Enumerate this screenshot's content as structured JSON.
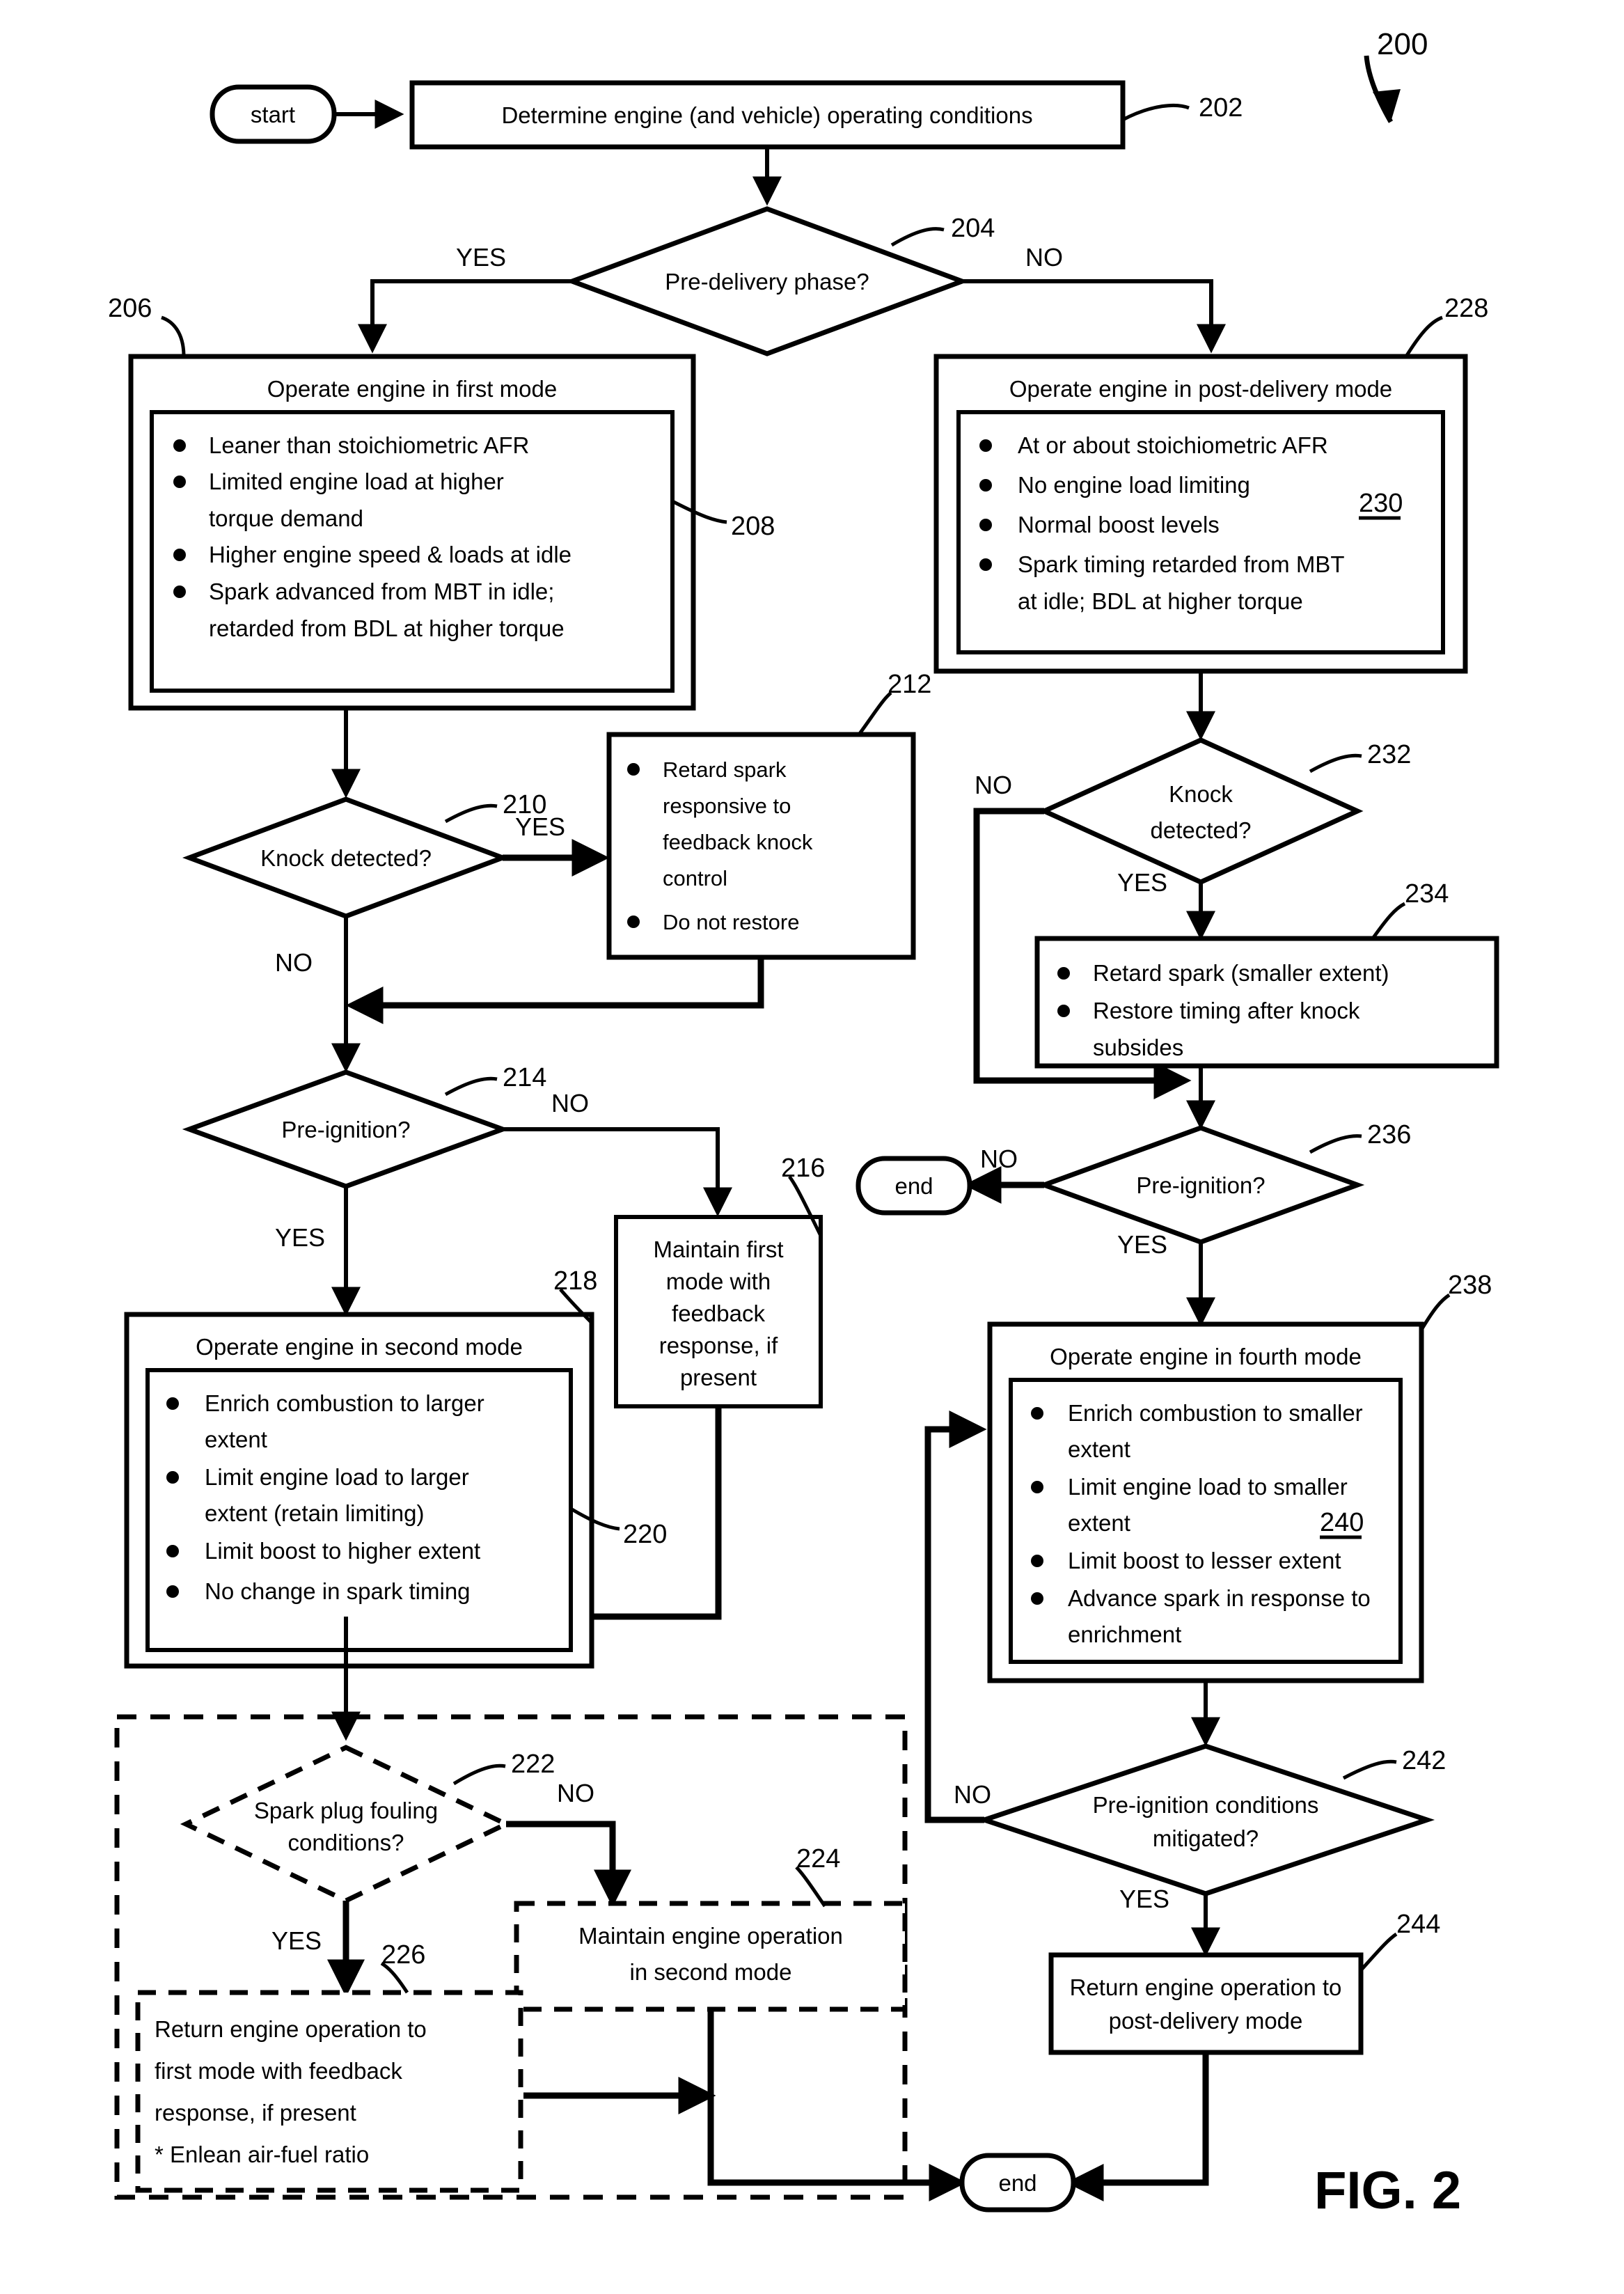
{
  "figure": {
    "label": "FIG. 2",
    "method_ref": "200"
  },
  "terminators": {
    "start": "start",
    "end_mid": "end",
    "end_bottom": "end"
  },
  "edge_labels": {
    "yes": "YES",
    "no": "NO"
  },
  "nodes": {
    "n202": {
      "ref": "202",
      "text": "Determine engine (and vehicle) operating conditions"
    },
    "n204": {
      "ref": "204",
      "text": "Pre-delivery phase?",
      "yes": "YES",
      "no": "NO"
    },
    "n206": {
      "ref": "206",
      "title": "Operate engine in first mode",
      "inner_ref": "208",
      "bullets": [
        "Leaner than stoichiometric AFR",
        "Limited engine load at higher torque demand",
        "Higher engine speed & loads at idle",
        "Spark advanced from MBT in idle; retarded from BDL at higher torque"
      ]
    },
    "n210": {
      "ref": "210",
      "text": "Knock detected?",
      "yes": "YES",
      "no": "NO"
    },
    "n212": {
      "ref": "212",
      "bullets": [
        "Retard spark responsive to feedback knock control",
        "Do not restore"
      ]
    },
    "n214": {
      "ref": "214",
      "text": "Pre-ignition?",
      "yes": "YES",
      "no": "NO"
    },
    "n216": {
      "ref": "216",
      "text": "Maintain first mode with feedback response, if present"
    },
    "n218": {
      "ref": "218",
      "title": "Operate engine in second mode",
      "inner_ref": "220",
      "bullets": [
        "Enrich combustion to larger extent",
        "Limit engine load to larger extent (retain limiting)",
        "Limit boost to higher extent",
        "No change in spark timing"
      ]
    },
    "n222": {
      "ref": "222",
      "text": "Spark plug fouling conditions?",
      "yes": "YES",
      "no": "NO"
    },
    "n224": {
      "ref": "224",
      "text": "Maintain engine operation in second mode"
    },
    "n226": {
      "ref": "226",
      "lines": [
        "Return engine operation to",
        "first mode with feedback",
        "response, if present",
        "* Enlean air-fuel ratio"
      ]
    },
    "n228": {
      "ref": "228",
      "title": "Operate engine in post-delivery mode",
      "inner_ref": "230",
      "bullets": [
        "At or about stoichiometric AFR",
        "No engine load limiting",
        "Normal boost levels",
        "Spark timing retarded from MBT at idle; BDL at higher torque"
      ]
    },
    "n232": {
      "ref": "232",
      "text_line1": "Knock",
      "text_line2": "detected?",
      "yes": "YES",
      "no": "NO"
    },
    "n234": {
      "ref": "234",
      "bullets": [
        "Retard spark (smaller extent)",
        "Restore timing after knock subsides"
      ]
    },
    "n236": {
      "ref": "236",
      "text": "Pre-ignition?",
      "yes": "YES",
      "no": "NO"
    },
    "n238": {
      "ref": "238",
      "title": "Operate engine in fourth mode",
      "inner_ref": "240",
      "bullets": [
        "Enrich combustion to smaller extent",
        "Limit engine load to smaller extent",
        "Limit boost to lesser extent",
        "Advance spark in response to enrichment"
      ]
    },
    "n242": {
      "ref": "242",
      "text_line1": "Pre-ignition conditions",
      "text_line2": "mitigated?",
      "yes": "YES",
      "no": "NO"
    },
    "n244": {
      "ref": "244",
      "line1": "Return engine operation to",
      "line2": "post-delivery mode"
    }
  },
  "colors": {
    "stroke": "#000000",
    "fill": "#ffffff"
  }
}
